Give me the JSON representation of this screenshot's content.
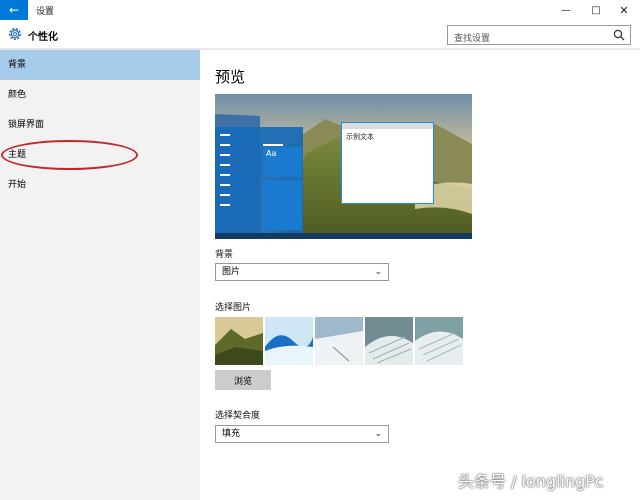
{
  "window": {
    "title": "设置",
    "back_glyph": "←",
    "minimize_glyph": "—",
    "maximize_glyph": "□",
    "close_glyph": "✕"
  },
  "header": {
    "title": "个性化",
    "search_placeholder": "查找设置"
  },
  "sidebar": {
    "items": [
      {
        "label": "背景",
        "selected": true
      },
      {
        "label": "颜色",
        "selected": false
      },
      {
        "label": "锁屏界面",
        "selected": false
      },
      {
        "label": "主题",
        "selected": false
      },
      {
        "label": "开始",
        "selected": false
      }
    ]
  },
  "main": {
    "preview_heading": "预览",
    "sample_window_text": "示例文本",
    "tile_label": "Aa",
    "background_label": "背景",
    "background_value": "图片",
    "choose_picture_label": "选择图片",
    "browse_label": "浏览",
    "fit_label": "选择契合度",
    "fit_value": "填充"
  },
  "icons": {
    "dropdown": "chevron-down-icon",
    "settings": "gear-icon",
    "search": "search-icon"
  },
  "colors": {
    "accent": "#0078d7",
    "selected_nav": "#a6cbeb",
    "highlight": "#c0282d"
  },
  "watermark": "头条号 / longlingPc"
}
